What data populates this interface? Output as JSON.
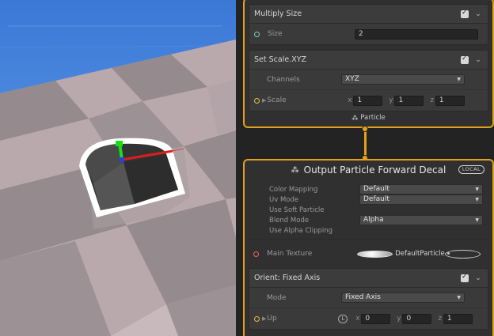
{
  "colors": {
    "sky": "#3b78d6",
    "floor_light": "#b9a9ad",
    "floor_dark": "#8f8387",
    "node_border": "#e3a21a",
    "gizmo_x": "#e01c1c",
    "gizmo_y": "#18e018",
    "gizmo_z": "#2244dd"
  },
  "multiply_size": {
    "title": "Multiply Size",
    "enabled": true,
    "size_label": "Size",
    "size_value": "2"
  },
  "set_scale": {
    "title": "Set Scale.XYZ",
    "enabled": true,
    "channels_label": "Channels",
    "channels_value": "XYZ",
    "scale_label": "Scale",
    "x_label": "x",
    "x_value": "1",
    "y_label": "y",
    "y_value": "1",
    "z_label": "z",
    "z_value": "1"
  },
  "particle_context": {
    "label": "Particle",
    "icon": "particle-icon"
  },
  "output_node": {
    "title": "Output Particle Forward Decal",
    "space_badge": "LOCAL",
    "settings": [
      {
        "label": "Color Mapping",
        "value": "Default",
        "has_select": true
      },
      {
        "label": "Uv Mode",
        "value": "Default",
        "has_select": true
      },
      {
        "label": "Use Soft Particle",
        "value": "",
        "has_select": false
      },
      {
        "label": "Blend Mode",
        "value": "Alpha",
        "has_select": true
      },
      {
        "label": "Use Alpha Clipping",
        "value": "",
        "has_select": false
      }
    ],
    "main_texture_label": "Main Texture",
    "main_texture_value": "DefaultParticle"
  },
  "orient": {
    "title": "Orient: Fixed Axis",
    "enabled": true,
    "mode_label": "Mode",
    "mode_value": "Fixed Axis",
    "up_label": "Up",
    "space_letter": "L",
    "x_label": "x",
    "x_value": "0",
    "y_label": "y",
    "y_value": "0",
    "z_label": "z",
    "z_value": "1"
  }
}
